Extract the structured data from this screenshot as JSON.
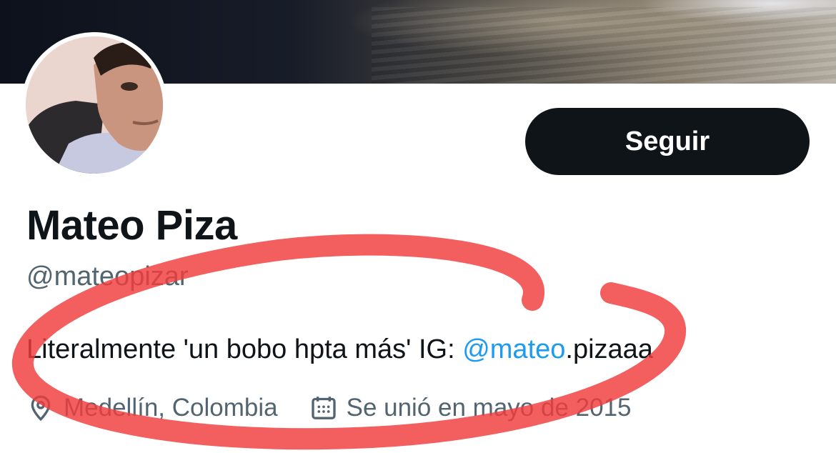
{
  "profile": {
    "display_name": "Mateo Piza",
    "handle": "@mateopizar",
    "bio_text": "Literalmente 'un bobo hpta más' IG: ",
    "bio_link_mention": "@mateo",
    "bio_link_rest": ".pizaaa",
    "location": "Medellín, Colombia",
    "joined": "Se unió en mayo de 2015"
  },
  "actions": {
    "follow_label": "Seguir"
  },
  "icons": {
    "location": "location-pin-icon",
    "calendar": "calendar-icon"
  },
  "colors": {
    "text_primary": "#0f1419",
    "text_secondary": "#536471",
    "link": "#1d9bf0",
    "button_bg": "#0f1419",
    "annotation": "#f03c3c"
  }
}
